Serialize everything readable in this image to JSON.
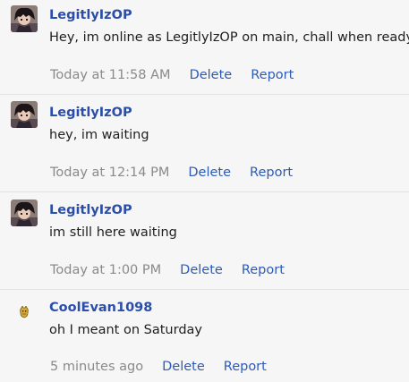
{
  "messages": [
    {
      "author": "LegitlyIzOP",
      "text": "Hey, im online as LegitlyIzOP on main, chall when ready",
      "time": "Today at 11:58 AM",
      "delete_label": "Delete",
      "report_label": "Report",
      "avatar": "user-avatar"
    },
    {
      "author": "LegitlyIzOP",
      "text": "hey, im waiting",
      "time": "Today at 12:14 PM",
      "delete_label": "Delete",
      "report_label": "Report",
      "avatar": "user-avatar"
    },
    {
      "author": "LegitlyIzOP",
      "text": "im still here waiting",
      "time": "Today at 1:00 PM",
      "delete_label": "Delete",
      "report_label": "Report",
      "avatar": "user-avatar"
    },
    {
      "author": "CoolEvan1098",
      "text": "oh I meant on Saturday",
      "time": "5 minutes ago",
      "delete_label": "Delete",
      "report_label": "Report",
      "avatar": "small-creature-icon"
    }
  ],
  "colors": {
    "author": "#2b4fa8",
    "link": "#2e5bb5",
    "timestamp": "#8a8a8a",
    "text": "#1e1e1e",
    "background": "#f6f6f6",
    "divider": "#e2e2e2"
  }
}
